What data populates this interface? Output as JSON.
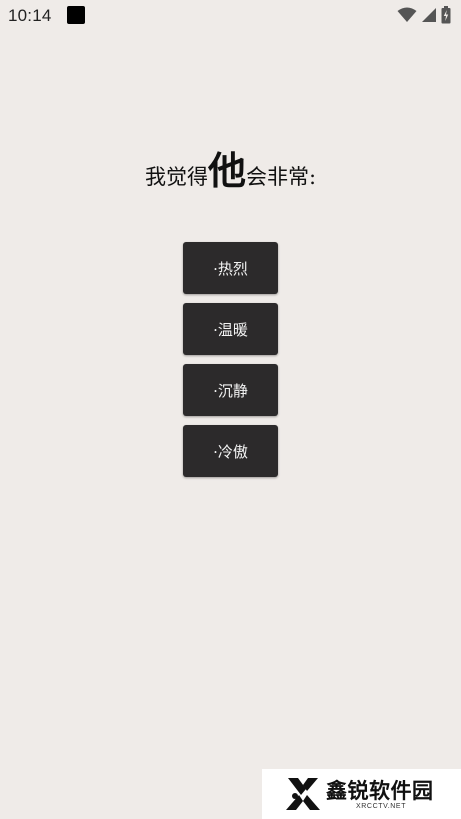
{
  "status_bar": {
    "time": "10:14",
    "icons": [
      "notification-square-icon",
      "wifi-icon",
      "cell-signal-icon",
      "battery-charging-icon"
    ]
  },
  "question": {
    "prefix": "我觉得",
    "emphasis": "他",
    "suffix": "会非常:"
  },
  "options": [
    "·热烈",
    "·温暖",
    "·沉静",
    "·冷傲"
  ],
  "watermark": {
    "title": "鑫锐软件园",
    "subtitle": "XRCCTV.NET"
  },
  "colors": {
    "background": "#efebe8",
    "button": "#2c2a2b",
    "button_text": "#f3f3f3",
    "text": "#111111"
  }
}
